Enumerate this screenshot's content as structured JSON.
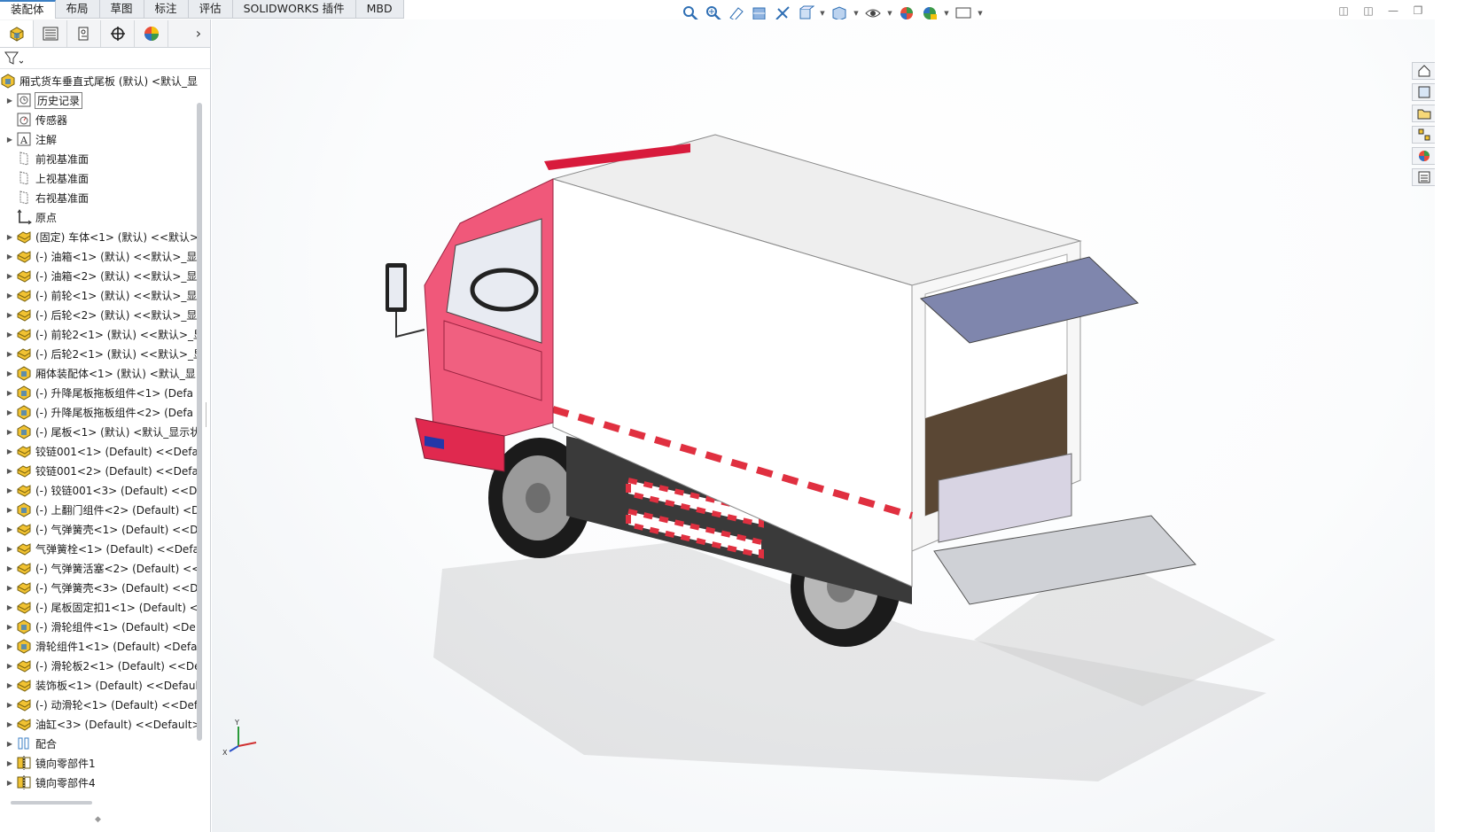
{
  "tabs": [
    {
      "label": "装配体",
      "active": true
    },
    {
      "label": "布局",
      "active": false
    },
    {
      "label": "草图",
      "active": false
    },
    {
      "label": "标注",
      "active": false
    },
    {
      "label": "评估",
      "active": false
    },
    {
      "label": "SOLIDWORKS 插件",
      "active": false
    },
    {
      "label": "MBD",
      "active": false
    }
  ],
  "hud_icons": [
    "zoom-to-fit-icon",
    "zoom-to-area-icon",
    "previous-view-icon",
    "section-view-icon",
    "dynamic-annotation-icon",
    "view-orientation-icon",
    "display-style-icon",
    "hide-show-items-icon",
    "edit-appearance-icon",
    "apply-scene-icon",
    "view-settings-icon"
  ],
  "feature_manager": {
    "panel_tabs": [
      "featuremanager-tab",
      "propertymanager-tab",
      "configurationmanager-tab",
      "dimxpertmanager-tab",
      "displaymanager-tab"
    ],
    "root": "厢式货车垂直式尾板 (默认) <默认_显",
    "items": [
      {
        "label": "历史记录",
        "icon": "history",
        "expand": true,
        "selected": true
      },
      {
        "label": "传感器",
        "icon": "sensor",
        "expand": false
      },
      {
        "label": "注解",
        "icon": "annotation",
        "expand": true
      },
      {
        "label": "前视基准面",
        "icon": "plane",
        "expand": false
      },
      {
        "label": "上视基准面",
        "icon": "plane",
        "expand": false
      },
      {
        "label": "右视基准面",
        "icon": "plane",
        "expand": false
      },
      {
        "label": "原点",
        "icon": "origin",
        "expand": false
      },
      {
        "label": "(固定) 车体<1> (默认) <<默认>",
        "icon": "part",
        "expand": true
      },
      {
        "label": "(-) 油箱<1> (默认) <<默认>_显",
        "icon": "part",
        "expand": true
      },
      {
        "label": "(-) 油箱<2> (默认) <<默认>_显",
        "icon": "part",
        "expand": true
      },
      {
        "label": "(-) 前轮<1> (默认) <<默认>_显",
        "icon": "part",
        "expand": true
      },
      {
        "label": "(-) 后轮<2> (默认) <<默认>_显",
        "icon": "part",
        "expand": true
      },
      {
        "label": "(-) 前轮2<1> (默认) <<默认>_显",
        "icon": "part",
        "expand": true
      },
      {
        "label": "(-) 后轮2<1> (默认) <<默认>_显",
        "icon": "part",
        "expand": true
      },
      {
        "label": "厢体装配体<1> (默认) <默认_显",
        "icon": "assembly",
        "expand": true
      },
      {
        "label": "(-) 升降尾板拖板组件<1> (Defa",
        "icon": "assembly",
        "expand": true
      },
      {
        "label": "(-) 升降尾板拖板组件<2> (Defa",
        "icon": "assembly",
        "expand": true
      },
      {
        "label": "(-) 尾板<1> (默认) <默认_显示状",
        "icon": "assembly",
        "expand": true
      },
      {
        "label": "铰链001<1> (Default) <<Defa",
        "icon": "part",
        "expand": true
      },
      {
        "label": "铰链001<2> (Default) <<Defa",
        "icon": "part",
        "expand": true
      },
      {
        "label": "(-) 铰链001<3> (Default) <<De",
        "icon": "part",
        "expand": true
      },
      {
        "label": "(-) 上翻门组件<2> (Default) <D",
        "icon": "assembly",
        "expand": true
      },
      {
        "label": "(-) 气弹簧壳<1> (Default) <<D",
        "icon": "part",
        "expand": true
      },
      {
        "label": "气弹簧栓<1> (Default) <<Defa",
        "icon": "part",
        "expand": true
      },
      {
        "label": "(-) 气弹簧活塞<2> (Default) <<",
        "icon": "part",
        "expand": true
      },
      {
        "label": "(-) 气弹簧壳<3> (Default) <<D",
        "icon": "part",
        "expand": true
      },
      {
        "label": "(-) 尾板固定扣1<1> (Default) <",
        "icon": "part",
        "expand": true
      },
      {
        "label": "(-) 滑轮组件<1> (Default) <De",
        "icon": "assembly",
        "expand": true
      },
      {
        "label": "滑轮组件1<1> (Default) <Defa",
        "icon": "assembly",
        "expand": true
      },
      {
        "label": "(-) 滑轮板2<1> (Default) <<De",
        "icon": "part",
        "expand": true
      },
      {
        "label": "装饰板<1> (Default) <<Defaul",
        "icon": "part",
        "expand": true
      },
      {
        "label": "(-) 动滑轮<1> (Default) <<Def",
        "icon": "part",
        "expand": true
      },
      {
        "label": "油缸<3> (Default) <<Default>",
        "icon": "part",
        "expand": true
      },
      {
        "label": "配合",
        "icon": "mates",
        "expand": true
      },
      {
        "label": "镜向零部件1",
        "icon": "mirror",
        "expand": true
      },
      {
        "label": "镜向零部件4",
        "icon": "mirror",
        "expand": true
      }
    ]
  },
  "task_pane_icons": [
    "solidworks-resources-icon",
    "design-library-icon",
    "file-explorer-icon",
    "view-palette-icon",
    "appearances-icon",
    "custom-properties-icon"
  ],
  "triad": {
    "y_label": "Y",
    "x_label": "X"
  },
  "colors": {
    "cab": "#f0587a",
    "box": "#ffffff",
    "ramp": "#c9cbd1",
    "door": "#7f86ad",
    "accent": "#3b7fc4"
  }
}
